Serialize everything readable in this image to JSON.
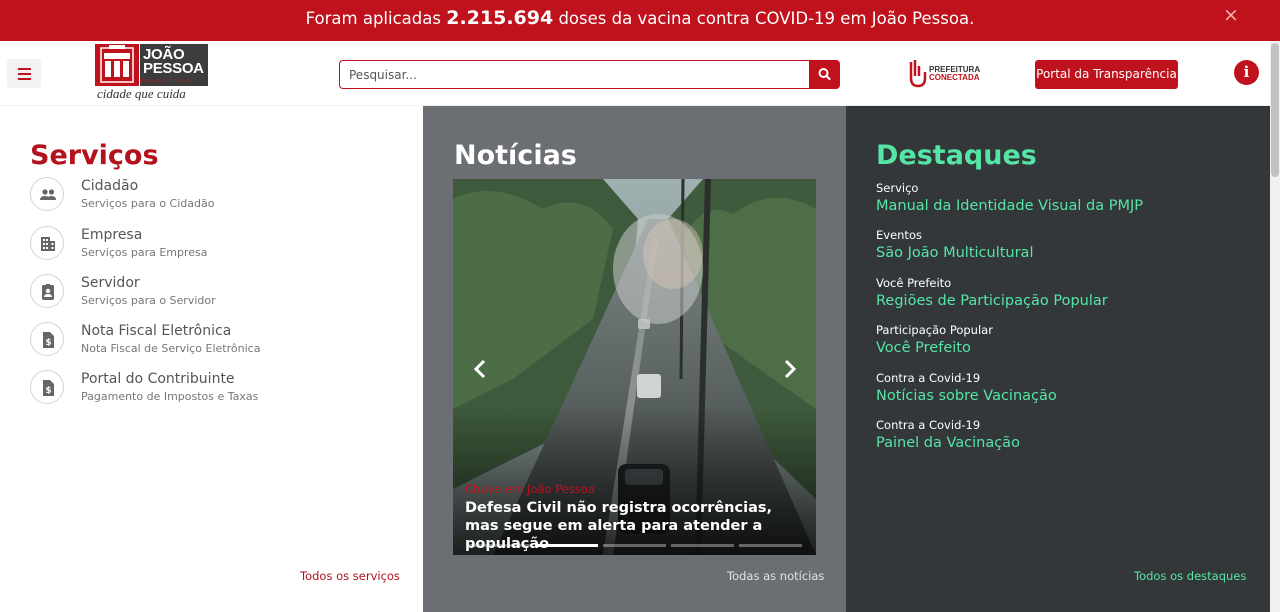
{
  "banner": {
    "prefix": "Foram aplicadas",
    "count": "2.215.694",
    "suffix": "doses da vacina contra COVID-19 em João Pessoa.",
    "close": "×"
  },
  "header": {
    "logo_line1": "JOÃO",
    "logo_line2": "PESSOA",
    "logo_sub": "PREFEITURA",
    "logo_tagline": "cidade que cuida",
    "search_placeholder": "Pesquisar...",
    "conectada_line1": "PREFEITURA",
    "conectada_line2": "CONECTADA",
    "transparencia_label": "Portal da Transparência",
    "info_label": "i"
  },
  "servicos": {
    "title": "Serviços",
    "items": [
      {
        "title": "Cidadão",
        "subtitle": "Serviços para o Cidadão",
        "icon": "people-icon"
      },
      {
        "title": "Empresa",
        "subtitle": "Serviços para Empresa",
        "icon": "building-icon"
      },
      {
        "title": "Servidor",
        "subtitle": "Serviços para o Servidor",
        "icon": "badge-icon"
      },
      {
        "title": "Nota Fiscal Eletrônica",
        "subtitle": "Nota Fiscal de Serviço Eletrônica",
        "icon": "invoice-icon"
      },
      {
        "title": "Portal do Contribuinte",
        "subtitle": "Pagamento de Impostos e Taxas",
        "icon": "invoice-icon"
      }
    ],
    "more": "Todos os serviços"
  },
  "noticias": {
    "title": "Notícias",
    "slide": {
      "category": "Chuva em João Pessoa",
      "headline": "Defesa Civil não registra ocorrências, mas segue em alerta para atender a população"
    },
    "slides_total": 5,
    "active_slide": 2,
    "more": "Todas as notícias"
  },
  "destaques": {
    "title": "Destaques",
    "items": [
      {
        "category": "Serviço",
        "link": "Manual da Identidade Visual da PMJP"
      },
      {
        "category": "Eventos",
        "link": "São João Multicultural"
      },
      {
        "category": "Você Prefeito",
        "link": "Regiões de Participação Popular"
      },
      {
        "category": "Participação Popular",
        "link": "Você Prefeito"
      },
      {
        "category": "Contra a Covid-19",
        "link": "Notícias sobre Vacinação"
      },
      {
        "category": "Contra a Covid-19",
        "link": "Painel da Vacinação"
      }
    ],
    "more": "Todos os destaques"
  },
  "colors": {
    "brand_red": "#c0121c",
    "noticias_bg": "#6b6e72",
    "destaques_bg": "#33373a",
    "destaques_accent": "#55e5a5"
  }
}
